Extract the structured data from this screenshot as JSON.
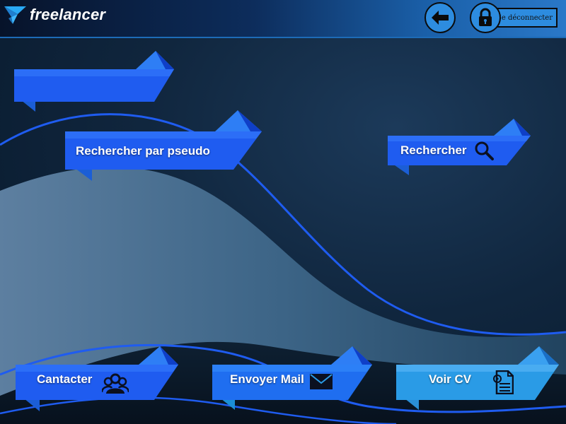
{
  "header": {
    "logo_text": "freelancer",
    "logout_label": "Se déconnecter"
  },
  "ribbons": {
    "title_ribbon": "",
    "search_pseudo": "Rechercher par pseudo",
    "search": "Rechercher",
    "contact": "Cantacter",
    "send_mail": "Envoyer Mail",
    "view_cv": "Voir CV"
  },
  "colors": {
    "accent": "#1f5cf0",
    "ribbon_light": "#2e7ef5",
    "ribbon_dark": "#0f3fc8",
    "ribbon_cyan": "#2a9be6",
    "header_right": "#2a78c8"
  }
}
